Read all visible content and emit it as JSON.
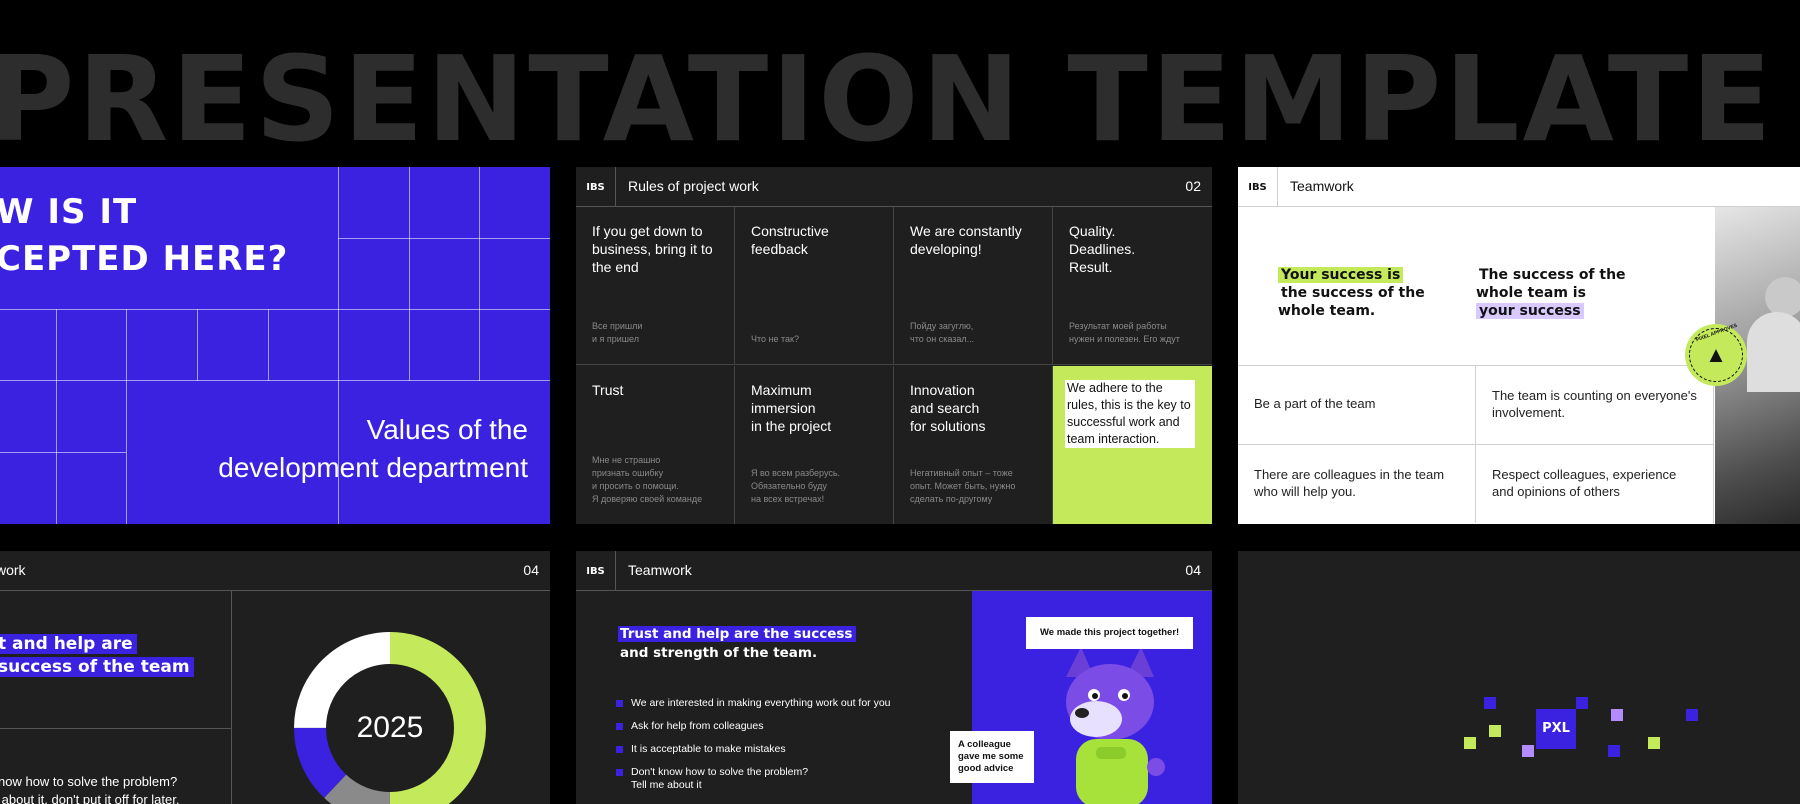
{
  "banner_title": "PRESENTATION TEMPLATE",
  "slide1": {
    "question_line1": "W IS IT",
    "question_line2": "CEPTED HERE?",
    "subtitle_line1": "Values of the",
    "subtitle_line2": "development department"
  },
  "slide2": {
    "logo": "IBS",
    "title": "Rules of project work",
    "number": "02",
    "cells": [
      {
        "title": "If you get down to business, bring it to the end",
        "note": "Все пришли\nи я пришел"
      },
      {
        "title": "Constructive feedback",
        "note": "Что не так?"
      },
      {
        "title": "We are constantly developing!",
        "note": "Пойду загуглю,\nчто он сказал..."
      },
      {
        "title": "Quality.\nDeadlines.\nResult.",
        "note": "Результат моей работы\nнужен и полезен. Его ждут"
      },
      {
        "title": "Trust",
        "note": "Мне не страшно\nпризнать ошибку\nи просить о помощи.\nЯ доверяю своей команде"
      },
      {
        "title": "Maximum\nimmersion\nin the project",
        "note": "Я во всем разберусь.\nОбязательно буду\nна всех встречах!"
      },
      {
        "title": "Innovation\nand search\nfor solutions",
        "note": "Негативный опыт – тоже\nопыт. Может быть, нужно\nсделать по-другому"
      },
      {
        "title": "We adhere to the rules, this is the key to successful work and team interaction.",
        "note": ""
      }
    ]
  },
  "slide3": {
    "logo": "IBS",
    "title": "Teamwork",
    "quote1_highlight": "Your success is",
    "quote1_rest": "the success of the whole team.",
    "quote2_start": "The success of the whole team is",
    "quote2_highlight": "your success",
    "cells": [
      "Be a part of the team",
      "The team is counting on everyone's involvement.",
      "There are colleagues in the team who will help you.",
      "Respect colleagues, experience and opinions of others"
    ],
    "badge_text": "PIXEL APPROVES"
  },
  "slide4": {
    "title": "work",
    "number": "04",
    "quote_line1": "t and help are",
    "quote_line2": "success of the team",
    "small_line1": "now how to solve the problem?",
    "small_line2": " about it, don't put it off for later.",
    "donut_label": "2025",
    "chart_data": {
      "type": "pie",
      "categories": [
        "green",
        "gray",
        "blue",
        "white"
      ],
      "values": [
        50,
        12,
        13,
        25
      ],
      "colors": [
        "#c4ea5c",
        "#8a8a8a",
        "#3a22e0",
        "#ffffff"
      ]
    }
  },
  "slide5": {
    "logo": "IBS",
    "title": "Teamwork",
    "number": "04",
    "quote_highlight": "Trust and help are the success",
    "quote_rest": "and strength of the team.",
    "bullets": [
      "We are interested in making everything work out for you",
      "Ask for help from colleagues",
      "It is acceptable to make mistakes",
      "Don't know how to solve the problem?\nTell me about it"
    ],
    "bubble1": "We made this project together!",
    "bubble2": "A colleague gave me some good advice"
  },
  "slide6": {
    "logo_text": "PXL"
  },
  "colors": {
    "blue": "#3a22e0",
    "green": "#c4ea5c",
    "purple": "#b38cff",
    "dark": "#1f1f1f"
  }
}
